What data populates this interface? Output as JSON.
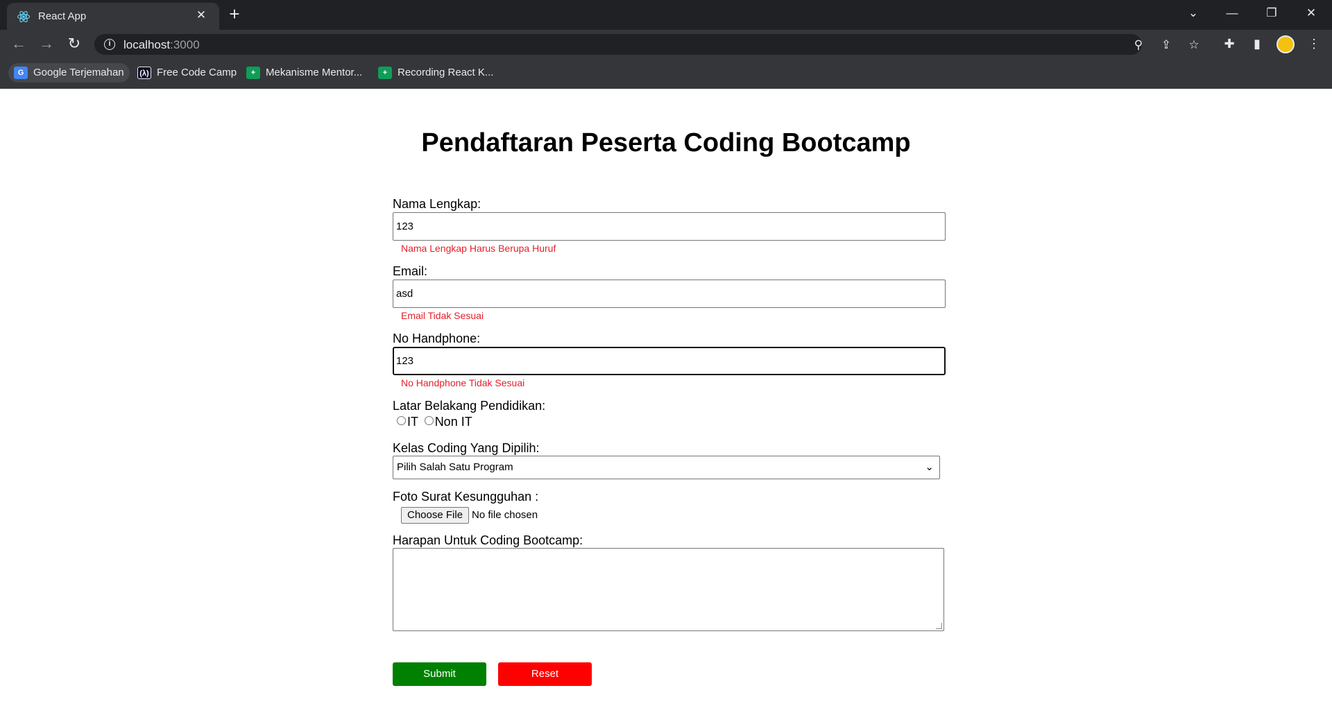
{
  "browser": {
    "tab_title": "React App",
    "tab_close": "✕",
    "new_tab": "+",
    "url_host": "localhost",
    "url_port": ":3000",
    "bookmarks": [
      {
        "label": "Google Terjemahan",
        "icon": "google-translate-icon",
        "glyph": "G"
      },
      {
        "label": "Free Code Camp",
        "icon": "freecodecamp-icon",
        "glyph": "(λ)"
      },
      {
        "label": "Mekanisme Mentor...",
        "icon": "google-sheets-icon",
        "glyph": "+"
      },
      {
        "label": "Recording React K...",
        "icon": "google-sheets-icon",
        "glyph": "+"
      }
    ]
  },
  "page": {
    "title": "Pendaftaran Peserta Coding Bootcamp",
    "fields": {
      "nama": {
        "label": "Nama Lengkap:",
        "value": "123",
        "error": "Nama Lengkap Harus Berupa Huruf"
      },
      "email": {
        "label": "Email:",
        "value": "asd",
        "error": "Email Tidak Sesuai"
      },
      "phone": {
        "label": "No Handphone:",
        "value": "123",
        "error": "No Handphone Tidak Sesuai"
      }
    },
    "pendidikan": {
      "label": "Latar Belakang Pendidikan:",
      "options": [
        "IT",
        "Non IT"
      ]
    },
    "kelas": {
      "label": "Kelas Coding Yang Dipilih:",
      "selected": "Pilih Salah Satu Program"
    },
    "foto": {
      "label": "Foto Surat Kesungguhan :",
      "button": "Choose File",
      "status": "No file chosen"
    },
    "harapan": {
      "label": "Harapan Untuk Coding Bootcamp:",
      "value": ""
    },
    "buttons": {
      "submit": "Submit",
      "reset": "Reset"
    },
    "colors": {
      "submit": "#008000",
      "reset": "#ff0000",
      "error": "#e4202b"
    }
  }
}
